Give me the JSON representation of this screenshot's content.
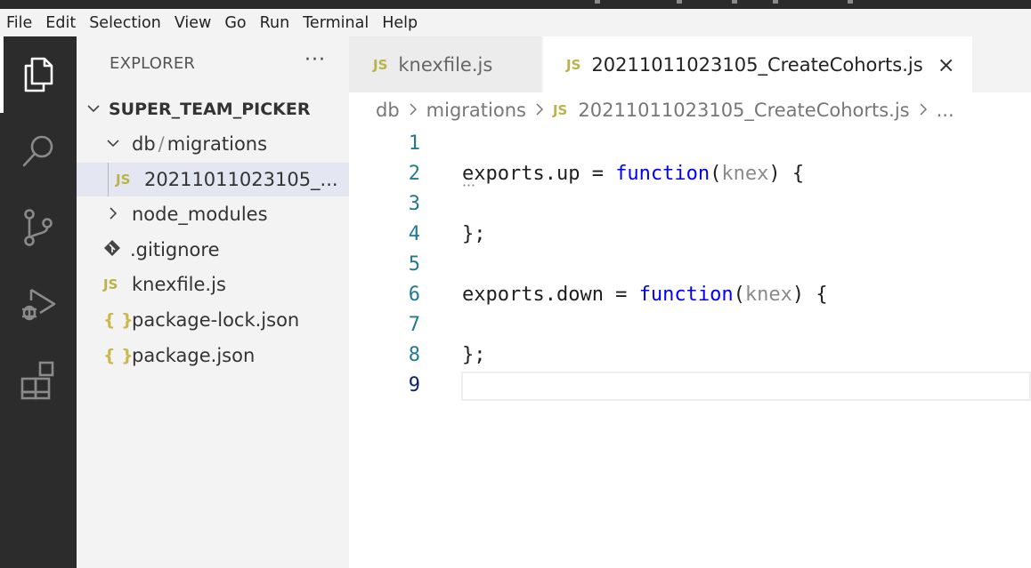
{
  "menubar": {
    "items": [
      "File",
      "Edit",
      "Selection",
      "View",
      "Go",
      "Run",
      "Terminal",
      "Help"
    ]
  },
  "activity_bar": {
    "icons": [
      "explorer-icon",
      "search-icon",
      "source-control-icon",
      "run-debug-icon",
      "extensions-icon"
    ]
  },
  "sidebar": {
    "title": "EXPLORER",
    "more": "···",
    "root": "SUPER_TEAM_PICKER",
    "folder_db": "db",
    "folder_sep": "/",
    "folder_migrations": "migrations",
    "file_migration": "20211011023105_...",
    "node_modules": "node_modules",
    "gitignore": ".gitignore",
    "knexfile": "knexfile.js",
    "package_lock": "package-lock.json",
    "package": "package.json",
    "js_badge": "JS",
    "json_badge": "{ }"
  },
  "tabs": {
    "inactive": "knexfile.js",
    "active": "20211011023105_CreateCohorts.js",
    "close": "×"
  },
  "breadcrumb": {
    "db": "db",
    "migrations": "migrations",
    "file": "20211011023105_CreateCohorts.js",
    "ellipsis": "..."
  },
  "editor": {
    "line_numbers": [
      "1",
      "2",
      "3",
      "4",
      "5",
      "6",
      "7",
      "8",
      "9"
    ],
    "line2_a": "exports.up = ",
    "line2_kw": "function",
    "line2_open": "(",
    "line2_param": "knex",
    "line2_close": ") {",
    "line4": "};",
    "line6_a": "exports.down = ",
    "line6_kw": "function",
    "line6_open": "(",
    "line6_param": "knex",
    "line6_close": ") {",
    "line8": "};"
  }
}
